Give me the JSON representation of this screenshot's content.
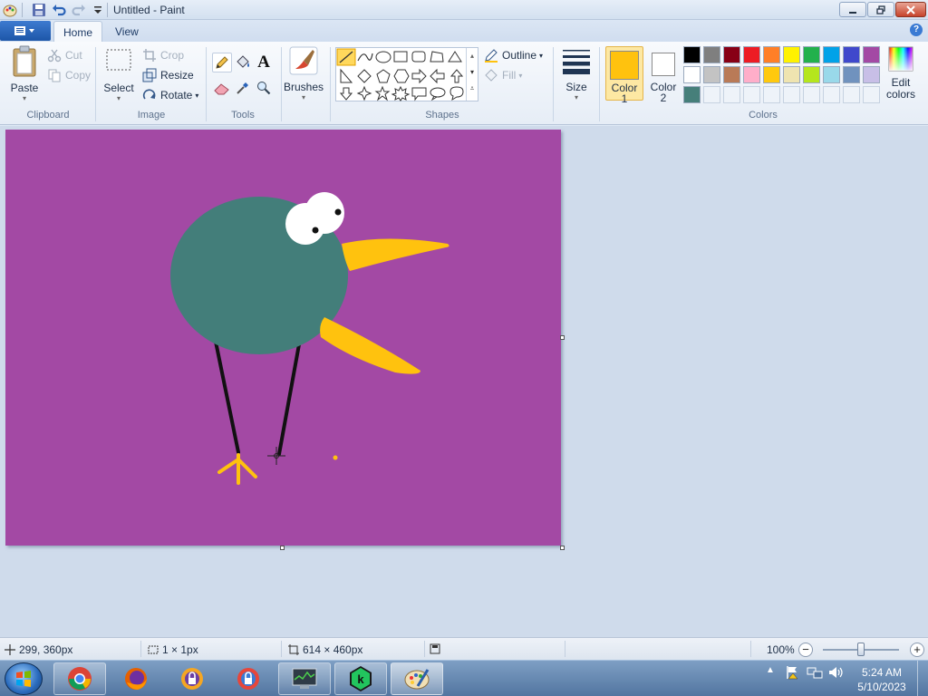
{
  "window": {
    "title": "Untitled - Paint"
  },
  "tabs": {
    "home": "Home",
    "view": "View"
  },
  "ribbon": {
    "clipboard": {
      "paste": "Paste",
      "cut": "Cut",
      "copy": "Copy",
      "label": "Clipboard"
    },
    "image": {
      "select": "Select",
      "crop": "Crop",
      "resize": "Resize",
      "rotate": "Rotate",
      "label": "Image"
    },
    "tools": {
      "label": "Tools",
      "text_glyph": "A"
    },
    "brushes": {
      "label": "Brushes"
    },
    "shapes": {
      "outline": "Outline",
      "fill": "Fill",
      "label": "Shapes"
    },
    "size": {
      "label": "Size"
    },
    "colors": {
      "color1_label": "Color",
      "color1_num": "1",
      "color2_label": "Color",
      "color2_num": "2",
      "edit_label_1": "Edit",
      "edit_label_2": "colors",
      "label": "Colors",
      "color1": "#ffc20e",
      "color2": "#ffffff",
      "palette_row1": [
        "#000000",
        "#7f7f7f",
        "#880015",
        "#ed1c24",
        "#ff7f27",
        "#fff200",
        "#22b14c",
        "#00a2e8",
        "#3f48cc",
        "#a349a4"
      ],
      "palette_row2": [
        "#ffffff",
        "#c3c3c3",
        "#b97a57",
        "#ffaec9",
        "#ffc90e",
        "#efe4b0",
        "#b5e61d",
        "#99d9ea",
        "#7092be",
        "#c8bfe7"
      ],
      "palette_row3_first": "#467f7a"
    }
  },
  "canvas": {
    "background": "#a349a4",
    "bird_body": "#437e7a",
    "beak": "#ffc20e",
    "legs": "#111111"
  },
  "status": {
    "cursor_pos": "299, 360px",
    "selection_size": "1 × 1px",
    "image_size": "614 × 460px",
    "zoom": "100%"
  },
  "taskbar": {
    "time": "5:24 AM",
    "date": "5/10/2023"
  }
}
